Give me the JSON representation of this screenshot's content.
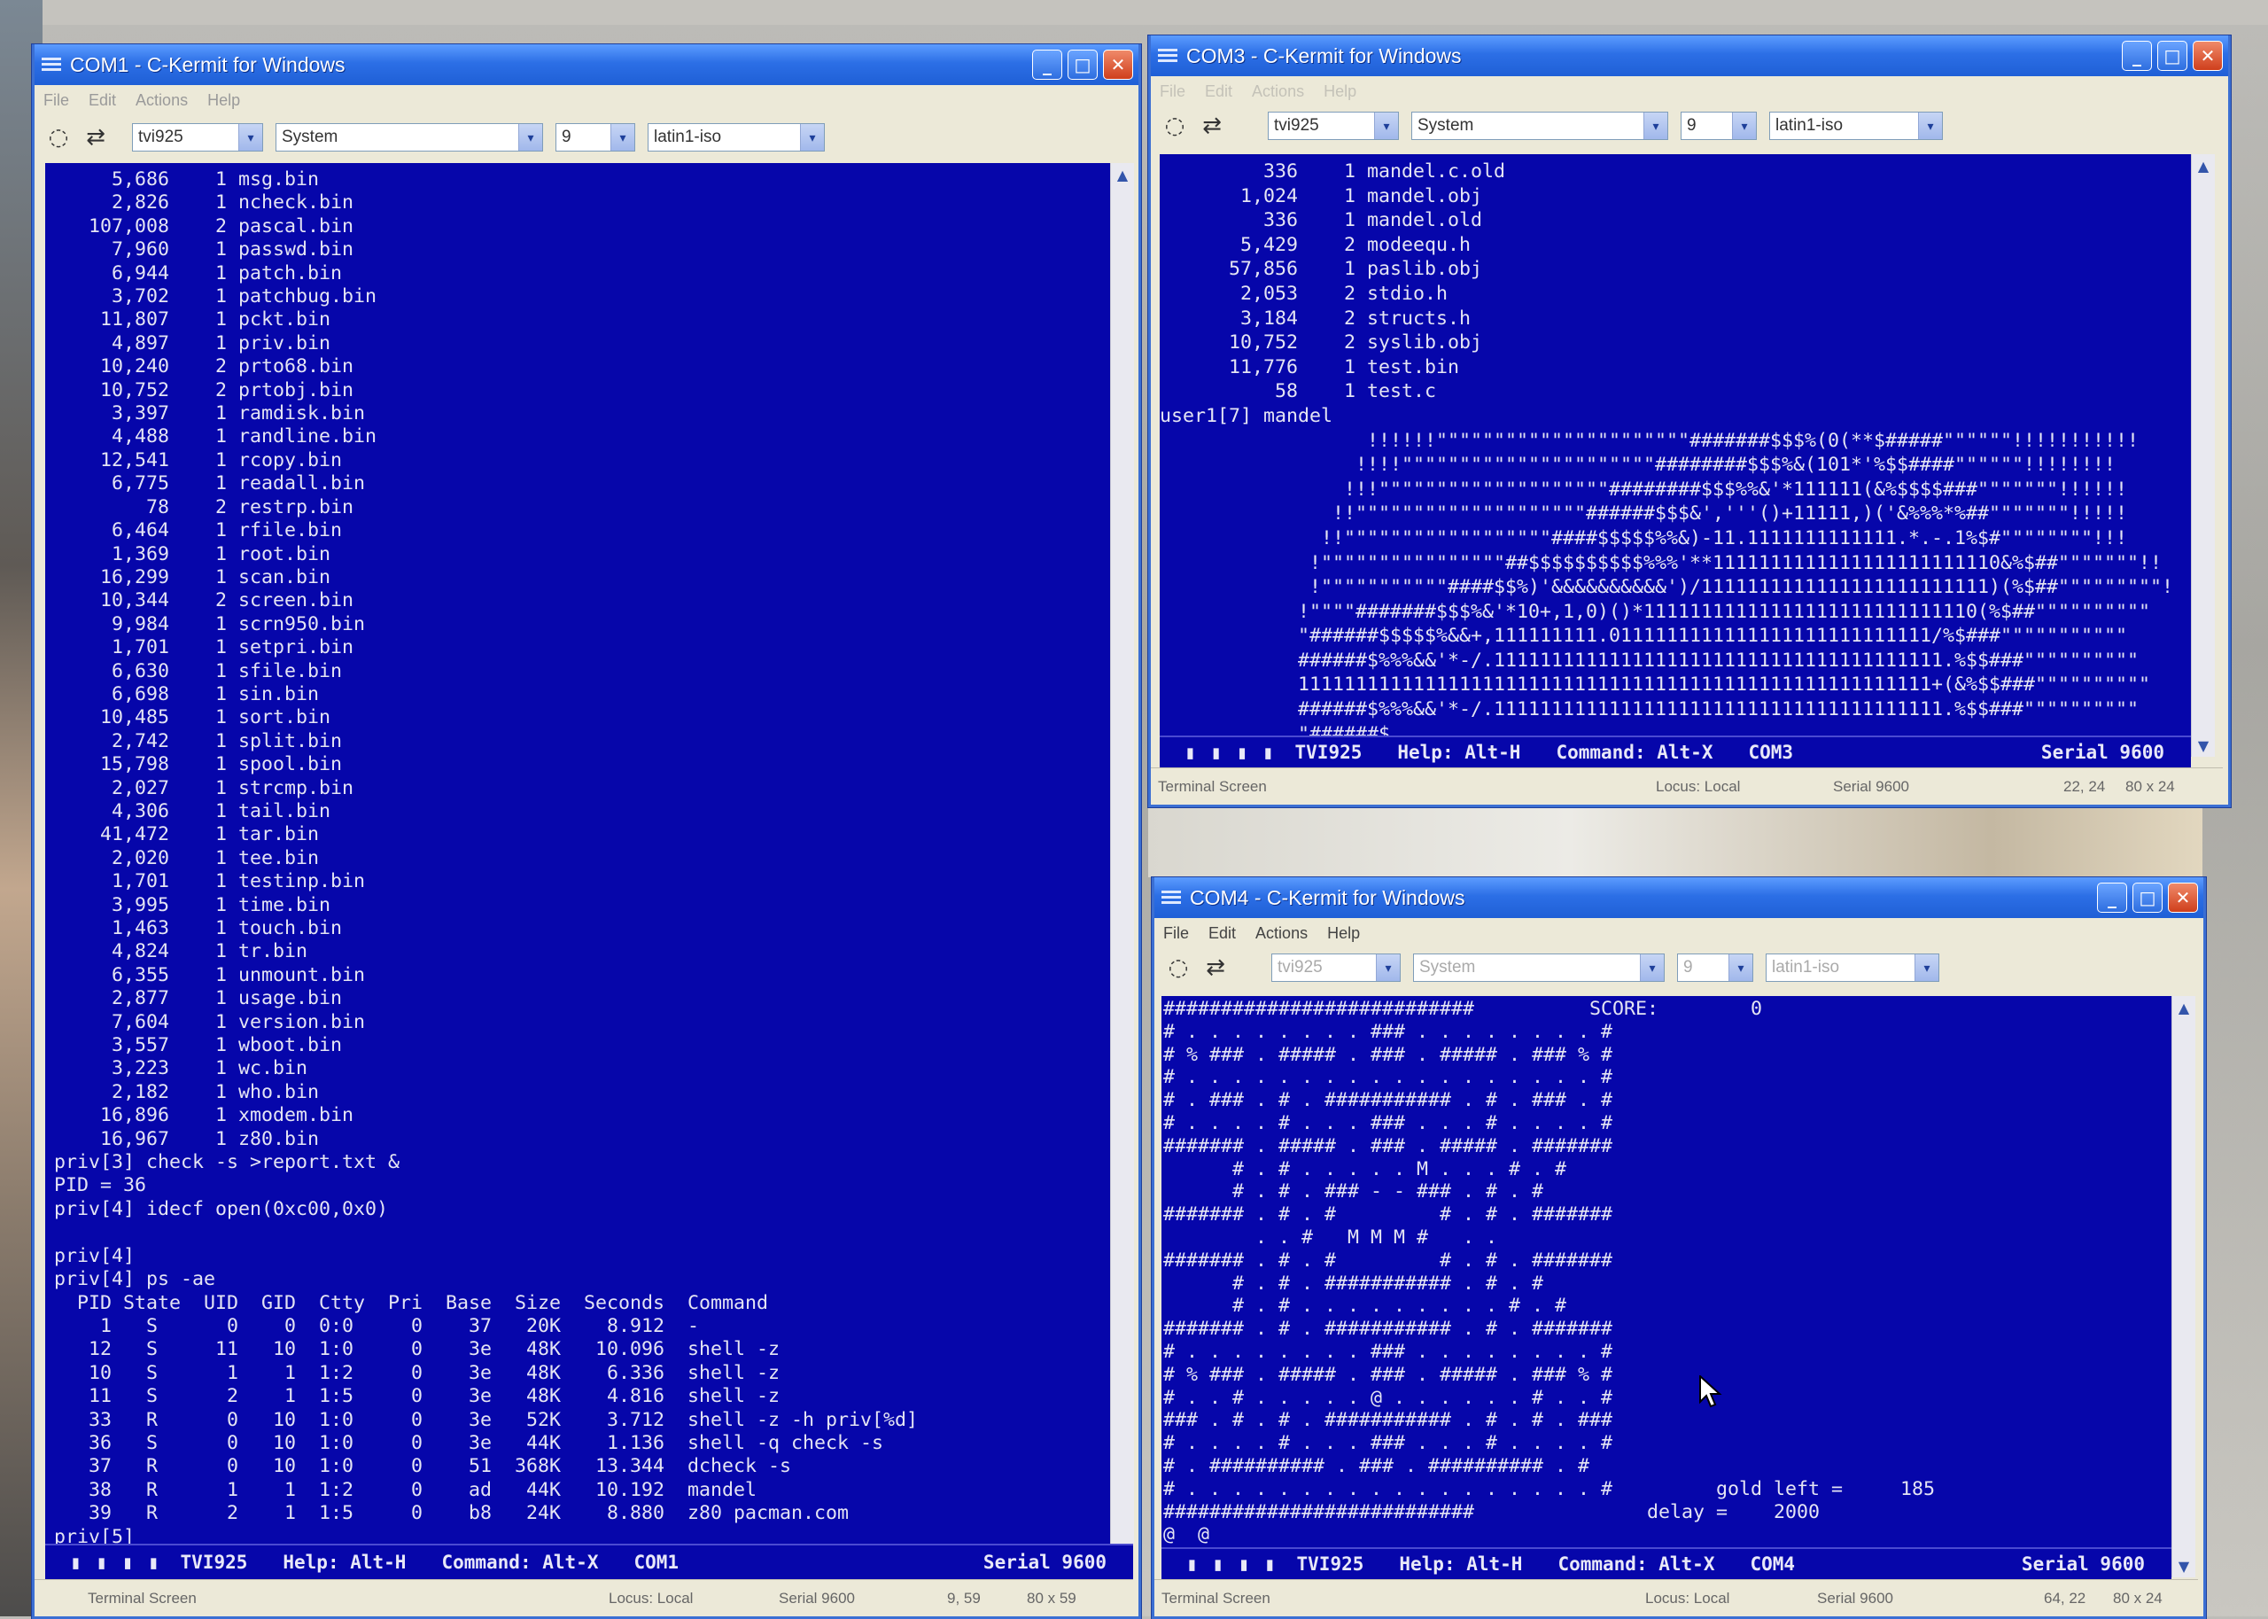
{
  "windows": {
    "com1": {
      "title": "COM1 - C-Kermit for Windows",
      "menu": [
        "File",
        "Edit",
        "Actions",
        "Help"
      ],
      "toolbar": {
        "terminal_type": "tvi925",
        "font": "System",
        "font_size": "9",
        "charset": "latin1-iso"
      },
      "screen_lines": [
        "     5,686    1 msg.bin",
        "     2,826    1 ncheck.bin",
        "   107,008    2 pascal.bin",
        "     7,960    1 passwd.bin",
        "     6,944    1 patch.bin",
        "     3,702    1 patchbug.bin",
        "    11,807    1 pckt.bin",
        "     4,897    1 priv.bin",
        "    10,240    2 prto68.bin",
        "    10,752    2 prtobj.bin",
        "     3,397    1 ramdisk.bin",
        "     4,488    1 randline.bin",
        "    12,541    1 rcopy.bin",
        "     6,775    1 readall.bin",
        "        78    2 restrp.bin",
        "     6,464    1 rfile.bin",
        "     1,369    1 root.bin",
        "    16,299    1 scan.bin",
        "    10,344    2 screen.bin",
        "     9,984    1 scrn950.bin",
        "     1,701    1 setpri.bin",
        "     6,630    1 sfile.bin",
        "     6,698    1 sin.bin",
        "    10,485    1 sort.bin",
        "     2,742    1 split.bin",
        "    15,798    1 spool.bin",
        "     2,027    1 strcmp.bin",
        "     4,306    1 tail.bin",
        "    41,472    1 tar.bin",
        "     2,020    1 tee.bin",
        "     1,701    1 testinp.bin",
        "     3,995    1 time.bin",
        "     1,463    1 touch.bin",
        "     4,824    1 tr.bin",
        "     6,355    1 unmount.bin",
        "     2,877    1 usage.bin",
        "     7,604    1 version.bin",
        "     3,557    1 wboot.bin",
        "     3,223    1 wc.bin",
        "     2,182    1 who.bin",
        "    16,896    1 xmodem.bin",
        "    16,967    1 z80.bin",
        "priv[3] check -s >report.txt &",
        "PID = 36",
        "priv[4] idecf open(0xc00,0x0)",
        "",
        "priv[4]",
        "priv[4] ps -ae",
        "  PID State  UID  GID  Ctty  Pri  Base  Size  Seconds  Command",
        "    1   S      0    0  0:0     0    37   20K    8.912  -",
        "   12   S     11   10  1:0     0    3e   48K   10.096  shell -z",
        "   10   S      1    1  1:2     0    3e   48K    6.336  shell -z",
        "   11   S      2    1  1:5     0    3e   48K    4.816  shell -z",
        "   33   R      0   10  1:0     0    3e   52K    3.712  shell -z -h priv[%d]",
        "   36   S      0   10  1:0     0    3e   44K    1.136  shell -q check -s",
        "   37   R      0   10  1:0     0    51  368K   13.344  dcheck -s",
        "   38   R      1    1  1:2     0    ad   44K   10.192  mandel",
        "   39   R      2    1  1:5     0    b8   24K    8.880  z80 pacman.com",
        "priv[5]"
      ],
      "kermit_status": {
        "blocks": "▮ ▮ ▮ ▮",
        "terminal": "TVI925",
        "help": "Help: Alt-H",
        "command": "Command: Alt-X",
        "port": "COM1",
        "speed": "Serial 9600"
      },
      "statusbar": {
        "mode": "Terminal Screen",
        "locus": "Locus: Local",
        "speed": "Serial 9600",
        "cursor": "9, 59",
        "size": "80 x 59"
      }
    },
    "com3": {
      "title": "COM3 - C-Kermit for Windows",
      "menu": [
        "File",
        "Edit",
        "Actions",
        "Help"
      ],
      "toolbar": {
        "terminal_type": "tvi925",
        "font": "System",
        "font_size": "9",
        "charset": "latin1-iso"
      },
      "screen_lines": [
        "         336    1 mandel.c.old",
        "       1,024    1 mandel.obj",
        "         336    1 mandel.old",
        "       5,429    2 modeequ.h",
        "      57,856    1 paslib.obj",
        "       2,053    2 stdio.h",
        "       3,184    2 structs.h",
        "      10,752    2 syslib.obj",
        "      11,776    1 test.bin",
        "          58    1 test.c",
        "user1[7] mandel",
        "                  !!!!!!\"\"\"\"\"\"\"\"\"\"\"\"\"\"\"\"\"\"\"\"\"\"#######$$$%(0(**$#####\"\"\"\"\"\"!!!!!!!!!!!",
        "                 !!!!\"\"\"\"\"\"\"\"\"\"\"\"\"\"\"\"\"\"\"\"\"\"########$$$%&(101*'%$$####\"\"\"\"\"\"!!!!!!!!",
        "                !!!\"\"\"\"\"\"\"\"\"\"\"\"\"\"\"\"\"\"\"\"########$$$%%&'*111111(&%$$$$###\"\"\"\"\"\"\"!!!!!!",
        "               !!\"\"\"\"\"\"\"\"\"\"\"\"\"\"\"\"\"\"\"\"######$$$&','''()+11111,)('&%%%*%##\"\"\"\"\"\"\"!!!!!",
        "              !!\"\"\"\"\"\"\"\"\"\"\"\"\"\"\"\"\"\"####$$$$$%%&)-11.1111111111111.*.-.1%$#\"\"\"\"\"\"\"\"!!!",
        "             !\"\"\"\"\"\"\"\"\"\"\"\"\"\"\"\"##$$$$$$$$$$%%%'**1111111111111111111111110&%$##\"\"\"\"\"\"\"!!",
        "             !\"\"\"\"\"\"\"\"\"\"\"####$$%)'&&&&&&&&&&')/1111111111111111111111111)(%$##\"\"\"\"\"\"\"\"\"!",
        "            !\"\"\"\"#######$$$%&'*10+,1,0)()*11111111111111111111111111110(%$##\"\"\"\"\"\"\"\"\"\"",
        "            \"######$$$$$%&&+,111111111.0111111111111111111111111111/%$###\"\"\"\"\"\"\"\"\"\"\"",
        "            ######$%%%&&'*-/.111111111111111111111111111111111111111.%$$###\"\"\"\"\"\"\"\"\"\"",
        "            1111111111111111111111111111111111111111111111111111111+(&%$$###\"\"\"\"\"\"\"\"\"\"",
        "            ######$%%%&&'*-/.111111111111111111111111111111111111111.%$$###\"\"\"\"\"\"\"\"\"\"",
        "            \"######$"
      ],
      "kermit_status": {
        "blocks": "▮ ▮ ▮ ▮",
        "terminal": "TVI925",
        "help": "Help: Alt-H",
        "command": "Command: Alt-X",
        "port": "COM3",
        "speed": "Serial 9600"
      },
      "statusbar": {
        "mode": "Terminal Screen",
        "locus": "Locus: Local",
        "speed": "Serial 9600",
        "cursor": "22, 24",
        "size": "80 x 24"
      }
    },
    "com4": {
      "title": "COM4 - C-Kermit for Windows",
      "menu": [
        "File",
        "Edit",
        "Actions",
        "Help"
      ],
      "toolbar": {
        "terminal_type": "tvi925",
        "font": "System",
        "font_size": "9",
        "charset": "latin1-iso"
      },
      "screen_lines": [
        "###########################          SCORE:        0",
        "# . . . . . . . . ### . . . . . . . . #",
        "# % ### . ##### . ### . ##### . ### % #",
        "# . . . . . . . . . . . . . . . . . . #",
        "# . ### . # . ########### . # . ### . #",
        "# . . . . # . . . ### . . . # . . . . #",
        "####### . ##### . ### . ##### . #######",
        "      # . # . . . . . M . . . # . #",
        "      # . # . ### - - ### . # . #",
        "####### . # . #         # . # . #######",
        "        . . #   M M M #   . .",
        "####### . # . #         # . # . #######",
        "      # . # . ########### . # . #",
        "      # . # . . . . . . . . . # . #",
        "####### . # . ########### . # . #######",
        "# . . . . . . . . ### . . . . . . . . #",
        "# % ### . ##### . ### . ##### . ### % #",
        "# . . # . . . . . @ . . . . . . # . . #",
        "### . # . # . ########### . # . # . ###",
        "# . . . . # . . . ### . . . # . . . . #",
        "# . ########## . ### . ########## . #",
        "# . . . . . . . . . . . . . . . . . . #         gold left =     185",
        "###########################               delay =    2000",
        "@  @"
      ],
      "kermit_status": {
        "blocks": "▮ ▮ ▮ ▮",
        "terminal": "TVI925",
        "help": "Help: Alt-H",
        "command": "Command: Alt-X",
        "port": "COM4",
        "speed": "Serial 9600"
      },
      "statusbar": {
        "mode": "Terminal Screen",
        "locus": "Locus: Local",
        "speed": "Serial 9600",
        "cursor": "64, 22",
        "size": "80 x 24"
      }
    }
  },
  "icons": {
    "app": "kermit-window-icon",
    "minimize": "_",
    "maximize": "□",
    "close": "✕",
    "reconnect": "◌",
    "transfer": "⇄",
    "dropdown": "▾",
    "scroll_up": "▲",
    "scroll_down": "▼"
  },
  "colors": {
    "terminal_bg": "#0606aa",
    "terminal_fg": "#e4e4f4",
    "titlebar": "#2c6fe6",
    "close_button": "#cf3f1c"
  }
}
